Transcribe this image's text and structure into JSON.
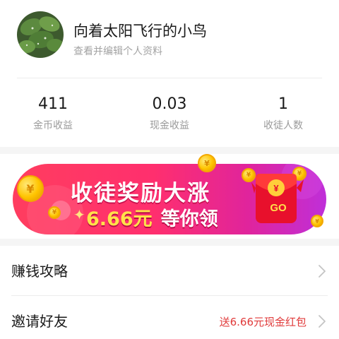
{
  "profile": {
    "username": "向着太阳飞行的小鸟",
    "subtitle": "查看并编辑个人资料"
  },
  "stats": [
    {
      "value": "411",
      "label": "金币收益"
    },
    {
      "value": "0.03",
      "label": "现金收益"
    },
    {
      "value": "1",
      "label": "收徒人数"
    }
  ],
  "banner": {
    "line1": "收徒奖励大涨",
    "amount": "6.66元",
    "line2_suffix": "等你领",
    "envelope_text": "GO",
    "colors": {
      "start": "#ff3d5f",
      "end": "#bf2fd9",
      "amount": "#ffe14a"
    }
  },
  "menu": [
    {
      "label": "赚钱攻略",
      "badge": ""
    },
    {
      "label": "邀请好友",
      "badge": "送6.66元现金红包"
    }
  ],
  "colors": {
    "badge": "#e03a3a",
    "muted": "#9a9a9a"
  },
  "icons": {
    "chevron": "chevron-right-icon",
    "coin": "coin-icon",
    "envelope": "red-envelope-icon"
  }
}
